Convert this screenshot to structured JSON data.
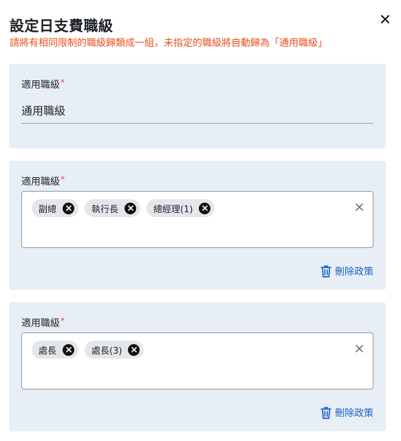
{
  "dialog": {
    "title": "設定日支費職級",
    "subtitle": "請將有相同限制的職級歸類成一組，未指定的職級將自動歸為「通用職級」"
  },
  "groups": [
    {
      "label": "適用職級",
      "required_mark": "*",
      "value": "通用職級"
    },
    {
      "label": "適用職級",
      "required_mark": "*",
      "chips": [
        "副總",
        "執行長",
        "總經理(1)"
      ],
      "delete_label": "刪除政策"
    },
    {
      "label": "適用職級",
      "required_mark": "*",
      "chips": [
        "處長",
        "處長(3)"
      ],
      "delete_label": "刪除政策"
    }
  ],
  "colors": {
    "accent": "#1e62c8",
    "warning": "#e8501e",
    "card_bg": "#e7eef5"
  }
}
